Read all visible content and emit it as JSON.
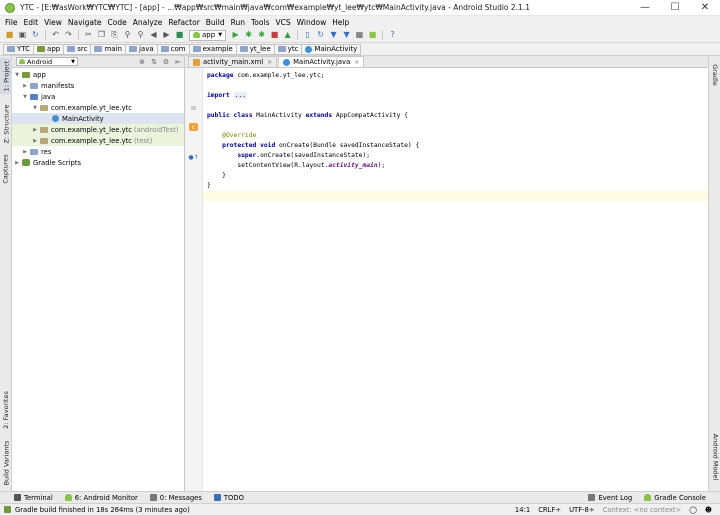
{
  "window": {
    "title": "YTC - [E:₩asWork₩YTC₩YTC] - [app] - ...₩app₩src₩main₩java₩com₩example₩yt_lee₩ytc₩MainActivity.java - Android Studio 2.1.1"
  },
  "menu": [
    "File",
    "Edit",
    "View",
    "Navigate",
    "Code",
    "Analyze",
    "Refactor",
    "Build",
    "Run",
    "Tools",
    "VCS",
    "Window",
    "Help"
  ],
  "toolbar": {
    "run_config": "app"
  },
  "breadcrumbs": [
    "YTC",
    "app",
    "src",
    "main",
    "java",
    "com",
    "example",
    "yt_lee",
    "ytc",
    "MainActivity"
  ],
  "left_tool_tabs": [
    "1: Project",
    "Z: Structure",
    "Captures",
    "2: Favorites",
    "Build Variants"
  ],
  "right_tool_tabs": [
    "Gradle",
    "Android Model"
  ],
  "project_panel": {
    "view": "Android",
    "tree": [
      {
        "label": "app",
        "suffix": ""
      },
      {
        "label": "manifests",
        "suffix": ""
      },
      {
        "label": "java",
        "suffix": ""
      },
      {
        "label": "com.example.yt_lee.ytc",
        "suffix": ""
      },
      {
        "label": "MainActivity",
        "suffix": ""
      },
      {
        "label": "com.example.yt_lee.ytc",
        "suffix": "(androidTest)"
      },
      {
        "label": "com.example.yt_lee.ytc",
        "suffix": "(test)"
      },
      {
        "label": "res",
        "suffix": ""
      },
      {
        "label": "Gradle Scripts",
        "suffix": ""
      }
    ]
  },
  "editor": {
    "tabs": [
      "activity_main.xml",
      "MainActivity.java"
    ],
    "active_tab": "MainActivity.java",
    "code": {
      "l1_kw": "package",
      "l1_rest": " com.example.yt_lee.ytc;",
      "l3_kw": "import",
      "l3_dots": "...",
      "l5_kw": "public class",
      "l5_name": " MainActivity ",
      "l5_kw2": "extends",
      "l5_rest": " AppCompatActivity {",
      "l7_ann": "@Override",
      "l8_kw": "protected void",
      "l8_rest": " onCreate(Bundle savedInstanceState) {",
      "l9_kw": "super",
      "l9_rest": ".onCreate(savedInstanceState);",
      "l10_pre": "setContentView(R.layout.",
      "l10_fld": "activity_main",
      "l10_post": ");",
      "l11": "}",
      "l12": "}"
    }
  },
  "bottom_tools": {
    "left": [
      "Terminal",
      "6: Android Monitor",
      "0: Messages",
      "TODO"
    ],
    "right": [
      "Event Log",
      "Gradle Console"
    ]
  },
  "status": {
    "message": "Gradle build finished in 18s 264ms (3 minutes ago)",
    "position": "14:1",
    "line_sep": "CRLF÷",
    "encoding": "UTF-8÷",
    "context": "Context: <no context>"
  }
}
